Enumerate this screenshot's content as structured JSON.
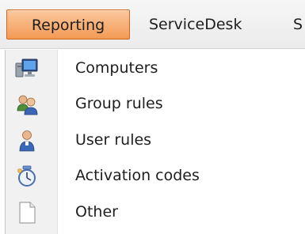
{
  "menubar": {
    "items": [
      {
        "label": "Reporting"
      },
      {
        "label": "ServiceDesk"
      },
      {
        "label": "S"
      }
    ]
  },
  "dropdown": {
    "items": [
      {
        "label": "Computers",
        "icon": "computer-icon"
      },
      {
        "label": "Group rules",
        "icon": "group-users-icon"
      },
      {
        "label": "User rules",
        "icon": "user-icon"
      },
      {
        "label": "Activation codes",
        "icon": "activation-codes-icon"
      },
      {
        "label": "Other",
        "icon": "blank-document-icon"
      }
    ]
  },
  "colors": {
    "active_menu_top": "#fbc89e",
    "active_menu_bottom": "#f39a54",
    "active_menu_border": "#d0641d",
    "gutter": "#f1f1f1"
  }
}
